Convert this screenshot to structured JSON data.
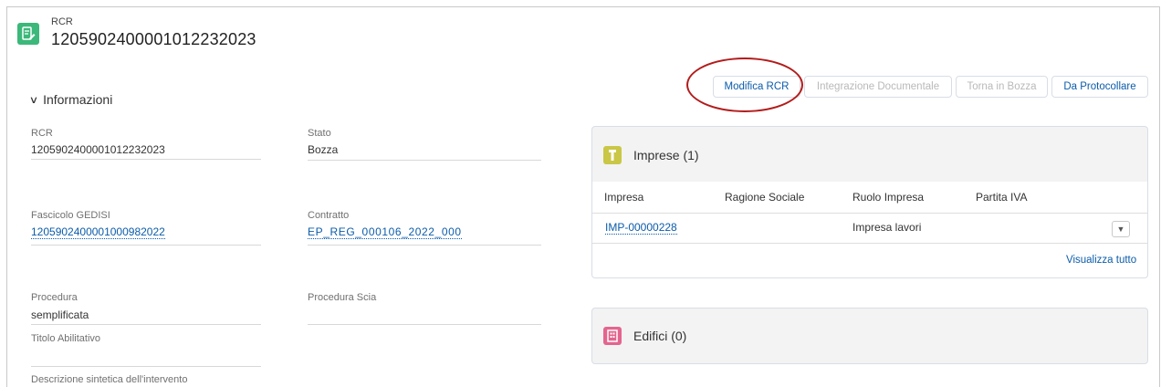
{
  "colors": {
    "record_icon": "#3bb87a",
    "imprese_icon": "#c9c745",
    "edifici_icon": "#e3658e",
    "link": "#0b5cab",
    "highlight_circle": "#b31b1b"
  },
  "header": {
    "object_type": "RCR",
    "record_name": "1205902400001012232023",
    "icon": "record-edit-icon"
  },
  "actions": [
    {
      "label": "Modifica RCR",
      "enabled": true,
      "highlighted": true
    },
    {
      "label": "Integrazione Documentale",
      "enabled": false
    },
    {
      "label": "Torna in Bozza",
      "enabled": false
    },
    {
      "label": "Da Protocollare",
      "enabled": true
    }
  ],
  "section": {
    "title": "Informazioni",
    "expanded": true
  },
  "fields": {
    "rcr": {
      "label": "RCR",
      "value": "1205902400001012232023"
    },
    "stato": {
      "label": "Stato",
      "value": "Bozza"
    },
    "fascicolo": {
      "label": "Fascicolo GEDISI",
      "value": "1205902400001000982022"
    },
    "contratto": {
      "label": "Contratto",
      "value": "EP_REG_000106_2022_000"
    },
    "procedura": {
      "label": "Procedura",
      "value": "semplificata"
    },
    "procedura_scia": {
      "label": "Procedura Scia",
      "value": ""
    },
    "titolo": {
      "label": "Titolo Abilitativo",
      "value": ""
    },
    "descrizione": {
      "label": "Descrizione sintetica dell'intervento",
      "value": ""
    }
  },
  "imprese": {
    "title": "Imprese (1)",
    "icon": "company-icon",
    "columns": [
      "Impresa",
      "Ragione Sociale",
      "Ruolo Impresa",
      "Partita IVA"
    ],
    "rows": [
      {
        "impresa": "IMP-00000228",
        "ragione_sociale": "",
        "ruolo": "Impresa lavori",
        "partita_iva": ""
      }
    ],
    "view_all": "Visualizza tutto"
  },
  "edifici": {
    "title": "Edifici (0)",
    "icon": "building-icon"
  }
}
